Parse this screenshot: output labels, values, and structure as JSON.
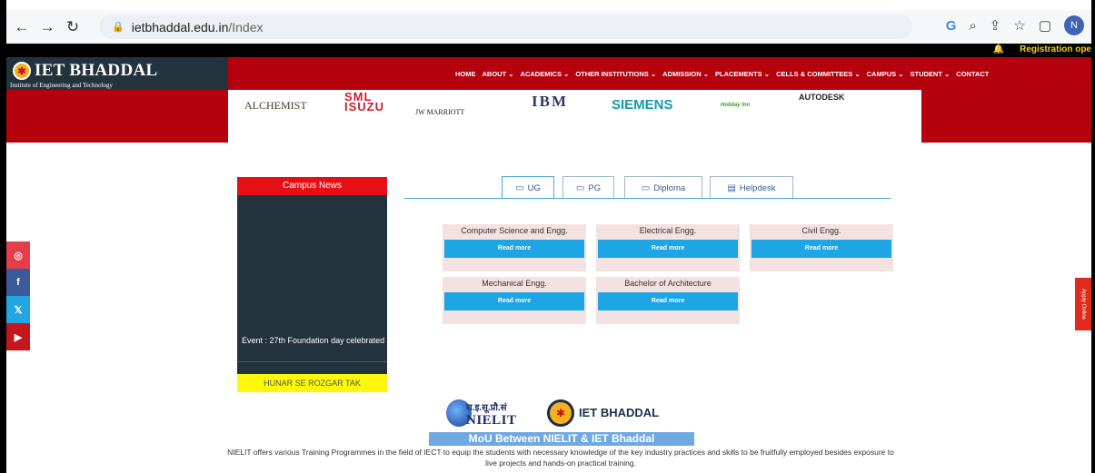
{
  "browser": {
    "domain": "ietbhaddal.edu.in",
    "path": "/Index",
    "avatar": "N",
    "g": "G"
  },
  "topbar": {
    "registration": "Registration ope"
  },
  "logo": {
    "title": "IET BHADDAL",
    "subtitle": "Institute of Engineering and Technology"
  },
  "menu": [
    "HOME",
    "ABOUT ⌄",
    "ACADEMICS ⌄",
    "OTHER INSTITUTIONS ⌄",
    "ADMISSION ⌄",
    "PLACEMENTS ⌄",
    "CELLS & COMMITTEES ⌄",
    "CAMPUS ⌄",
    "STUDENT ⌄",
    "CONTACT"
  ],
  "brands": [
    "ALCHEMIST",
    "SML ISUZU",
    "JW MARRIOTT",
    "IBM",
    "SIEMENS",
    "Holiday Inn",
    "AUTODESK"
  ],
  "news": {
    "header": "Campus News",
    "item": "Event : 27th Foundation day celebrated",
    "banner": "HUNAR SE ROZGAR TAK"
  },
  "tabs": [
    "UG",
    "PG",
    "Diploma",
    "Helpdesk"
  ],
  "courses": [
    {
      "name": "Computer Science and Engg.",
      "button": "Read more"
    },
    {
      "name": "Electrical Engg.",
      "button": "Read more"
    },
    {
      "name": "Civil Engg.",
      "button": "Read more"
    },
    {
      "name": "Mechanical Engg.",
      "button": "Read more"
    },
    {
      "name": "Bachelor of Architecture",
      "button": "Read more"
    }
  ],
  "social": [
    {
      "icon": "instagram-icon",
      "glyph": "◎",
      "color": "#e33e4a"
    },
    {
      "icon": "facebook-icon",
      "glyph": "f",
      "color": "#3b5a9a"
    },
    {
      "icon": "x-icon",
      "glyph": "𝕏",
      "color": "#22a7e3"
    },
    {
      "icon": "youtube-icon",
      "glyph": "▶",
      "color": "#c4161c"
    }
  ],
  "apply": "Apply Online",
  "mou": {
    "nielit_hindi": "रा.इ.सू.प्रौ.सं",
    "nielit": "NIELIT",
    "iet": "IET BHADDAL",
    "title": "MoU Between NIELIT & IET Bhaddal",
    "description": "NIELIT offers various Training Programmes in the field of IECT to equip the students with necessary knowledge of the key industry practices and skills to be fruitfully employed besides exposure to live projects and hands-on practical training."
  }
}
